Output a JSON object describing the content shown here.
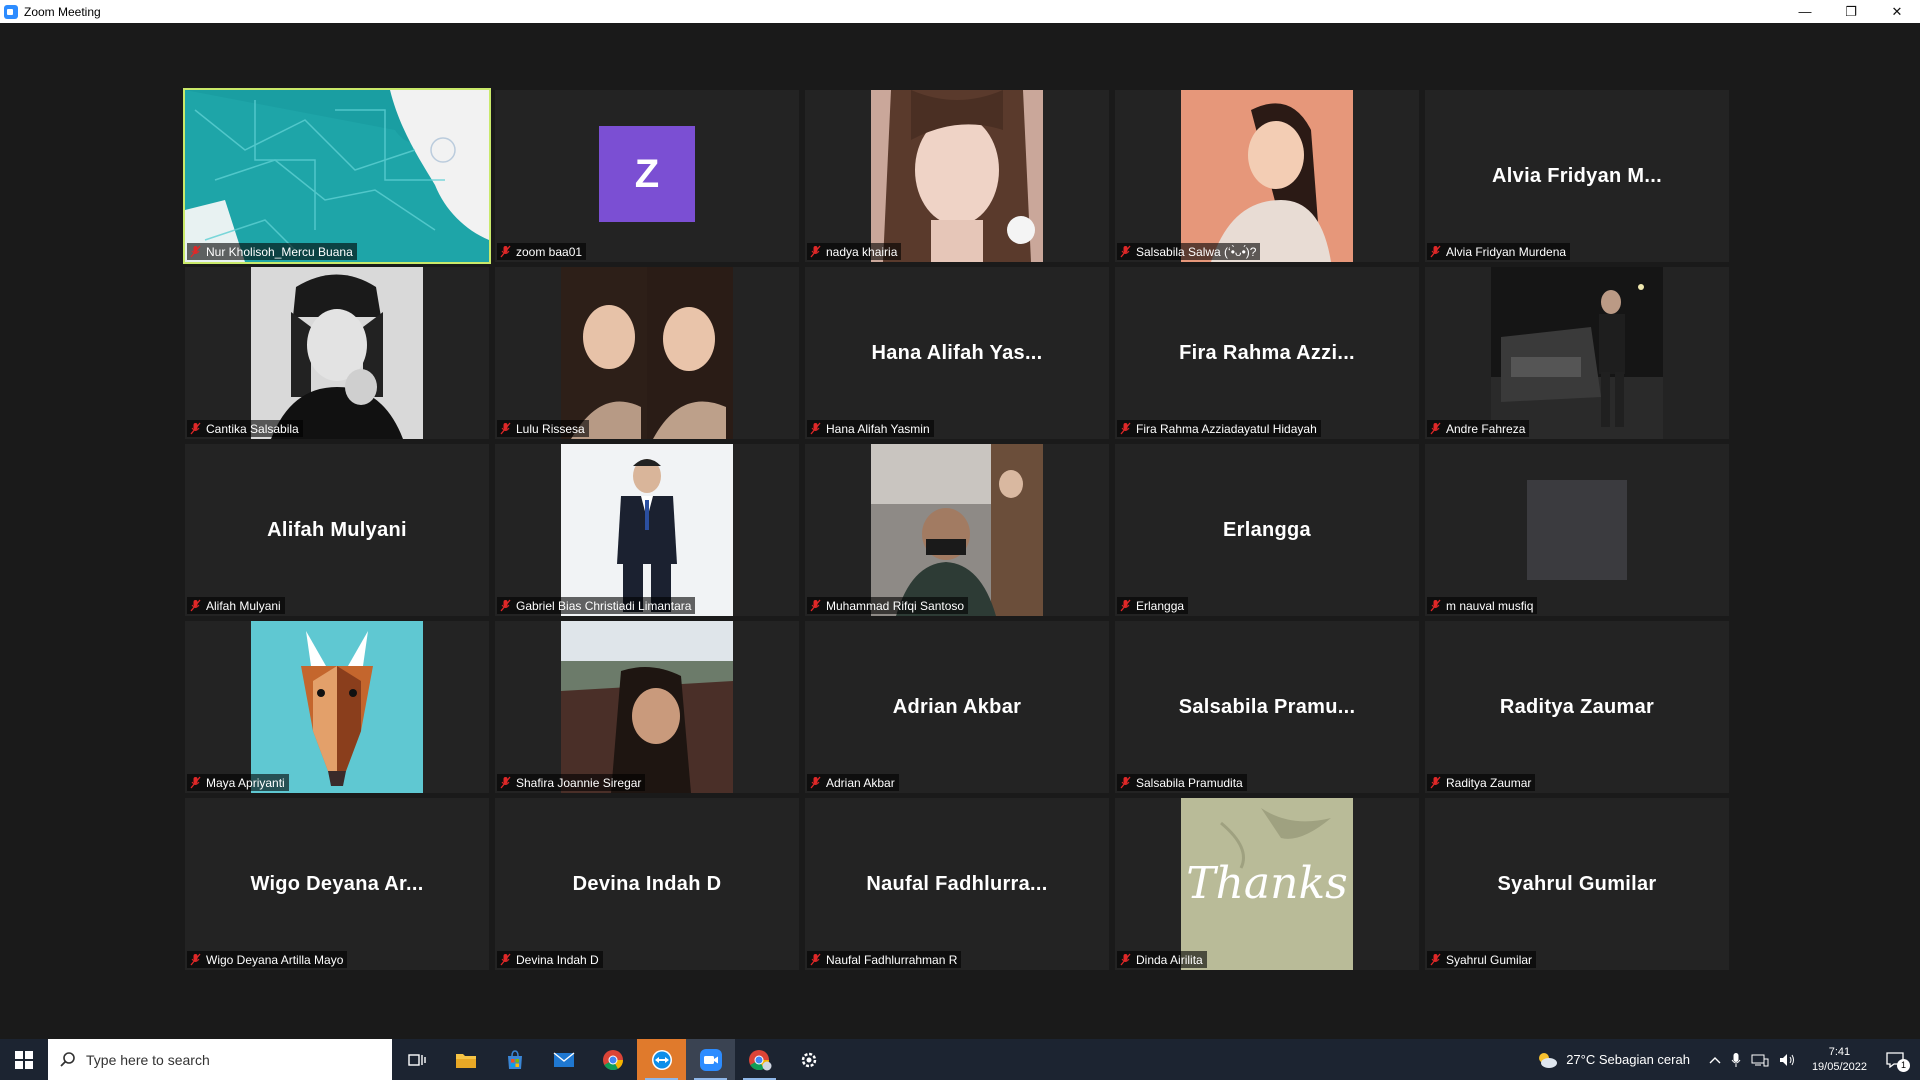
{
  "window": {
    "title": "Zoom Meeting"
  },
  "participants": [
    {
      "name": "Nur Kholisoh_Mercu Buana",
      "display": "",
      "type": "photo",
      "active": true
    },
    {
      "name": "zoom baa01",
      "display": "Z",
      "type": "letter"
    },
    {
      "name": "nadya khairia",
      "display": "",
      "type": "photo"
    },
    {
      "name": "Salsabila Salwa (‘•̀ᴗ•́)?",
      "display": "",
      "type": "photo"
    },
    {
      "name": "Alvia Fridyan Murdena",
      "display": "Alvia  Fridyan  M...",
      "type": "text"
    },
    {
      "name": "Cantika Salsabila",
      "display": "",
      "type": "photo"
    },
    {
      "name": "Lulu Rissesa",
      "display": "",
      "type": "photo"
    },
    {
      "name": "Hana Alifah Yasmin",
      "display": "Hana  Alifah  Yas...",
      "type": "text"
    },
    {
      "name": "Fira Rahma Azziadayatul Hidayah",
      "display": "Fira  Rahma  Azzi...",
      "type": "text"
    },
    {
      "name": "Andre Fahreza",
      "display": "",
      "type": "photo"
    },
    {
      "name": "Alifah Mulyani",
      "display": "Alifah Mulyani",
      "type": "text"
    },
    {
      "name": "Gabriel Bias Christiadi Limantara",
      "display": "",
      "type": "photo"
    },
    {
      "name": "Muhammad Rifqi Santoso",
      "display": "",
      "type": "photo"
    },
    {
      "name": "Erlangga",
      "display": "Erlangga",
      "type": "text"
    },
    {
      "name": "m nauval musfiq",
      "display": "",
      "type": "blank"
    },
    {
      "name": "Maya Apriyanti",
      "display": "",
      "type": "photo"
    },
    {
      "name": "Shafira Joannie Siregar",
      "display": "",
      "type": "photo"
    },
    {
      "name": "Adrian Akbar",
      "display": "Adrian Akbar",
      "type": "text"
    },
    {
      "name": "Salsabila Pramudita",
      "display": "Salsabila  Pramu...",
      "type": "text"
    },
    {
      "name": "Raditya Zaumar",
      "display": "Raditya Zaumar",
      "type": "text"
    },
    {
      "name": "Wigo Deyana Artilla Mayo",
      "display": "Wigo  Deyana  Ar...",
      "type": "text"
    },
    {
      "name": "Devina Indah D",
      "display": "Devina Indah D",
      "type": "text"
    },
    {
      "name": "Naufal Fadhlurrahman R",
      "display": "Naufal  Fadhlurra...",
      "type": "text"
    },
    {
      "name": "Dinda Airilita",
      "display": "Thanks",
      "type": "photo"
    },
    {
      "name": "Syahrul Gumilar",
      "display": "Syahrul Gumilar",
      "type": "text"
    }
  ],
  "taskbar": {
    "search_placeholder": "Type here to search",
    "apps": [
      "task-view-icon",
      "file-explorer-icon",
      "store-icon",
      "mail-icon",
      "chrome-icon",
      "teamviewer-icon",
      "zoom-icon",
      "chrome-profile-icon",
      "settings-icon"
    ],
    "weather": "27°C  Sebagian cerah",
    "time": "7:41",
    "date": "19/05/2022",
    "notification_count": "1"
  },
  "colors": {
    "active_speaker": "#c9e96a",
    "avatar_letter_bg": "#7b4fd3",
    "muted_mic": "#e02828",
    "taskbar": "#1c2431"
  }
}
